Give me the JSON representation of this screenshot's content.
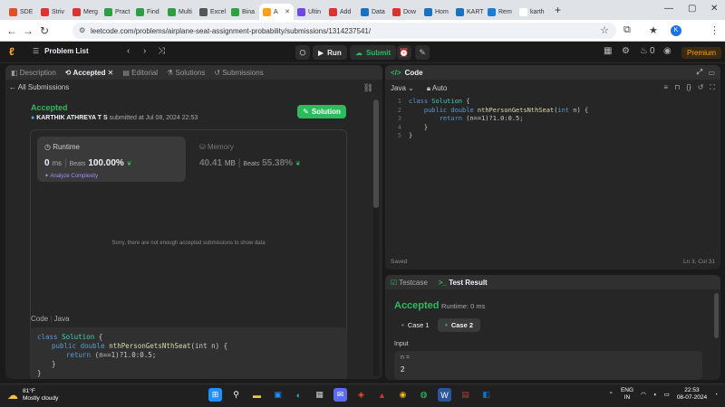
{
  "browser": {
    "tabs": [
      {
        "label": "SDE",
        "color": "#e44d26"
      },
      {
        "label": "Striv",
        "color": "#e03131"
      },
      {
        "label": "Merg",
        "color": "#e03131"
      },
      {
        "label": "Pract",
        "color": "#2f9e44"
      },
      {
        "label": "Find",
        "color": "#2f9e44"
      },
      {
        "label": "Multi",
        "color": "#2f9e44"
      },
      {
        "label": "Excel",
        "color": "#555555"
      },
      {
        "label": "Bina",
        "color": "#2f9e44"
      },
      {
        "label": "A",
        "color": "#ffa116",
        "active": true
      },
      {
        "label": "Ultin",
        "color": "#7048e8"
      },
      {
        "label": "Add",
        "color": "#e03131"
      },
      {
        "label": "Data",
        "color": "#1971c2"
      },
      {
        "label": "Dow",
        "color": "#e03131"
      },
      {
        "label": "Hom",
        "color": "#1971c2"
      },
      {
        "label": "KART",
        "color": "#1971c2"
      },
      {
        "label": "Rem",
        "color": "#1c7ed6"
      },
      {
        "label": "karth",
        "color": "#ffffff"
      }
    ],
    "url": "leetcode.com/problems/airplane-seat-assignment-probability/submissions/1314237541/",
    "profile_initial": "K"
  },
  "lc": {
    "problem_list": "Problem List",
    "run": "Run",
    "submit": "Submit",
    "streak": "0",
    "premium": "Premium"
  },
  "left": {
    "tabs": [
      "Description",
      "Accepted",
      "Editorial",
      "Solutions",
      "Submissions"
    ],
    "all_submissions": "All Submissions",
    "status": "Accepted",
    "author": "KARTHIK ATHREYA T S",
    "submitted": "submitted at Jul 08, 2024 22:53",
    "solution_btn": "Solution",
    "runtime": {
      "label": "Runtime",
      "value": "0",
      "unit": "ms",
      "beats_label": "Beats",
      "beats": "100.00%"
    },
    "analyze": "Analyze Complexity",
    "memory": {
      "label": "Memory",
      "value": "40.41",
      "unit": "MB",
      "beats_label": "Beats",
      "beats": "55.38%"
    },
    "nodata": "Sorry, there are not enough accepted submissions to show data",
    "code_label": "Code",
    "code_lang": "Java",
    "code": {
      "l1a": "class",
      "l1b": "Solution",
      "l1c": " {",
      "l2a": "public",
      "l2b": "double",
      "l2c": "nthPersonGetsNthSeat",
      "l2d": "(int n) {",
      "l3a": "return",
      "l3b": " (n==1)?1.0:0.5;",
      "l4": "}",
      "l5": "}"
    }
  },
  "editor": {
    "title": "Code",
    "lang": "Java",
    "mode": "Auto",
    "lines": [
      {
        "n": "1",
        "text": "class Solution {"
      },
      {
        "n": "2",
        "text": "    public double nthPersonGetsNthSeat(int n) {"
      },
      {
        "n": "3",
        "text": "        return (n==1)?1.0:0.5;"
      },
      {
        "n": "4",
        "text": "    }"
      },
      {
        "n": "5",
        "text": "}"
      }
    ],
    "saved": "Saved",
    "position": "Ln 3, Col 31"
  },
  "test": {
    "tab_testcase": "Testcase",
    "tab_result": "Test Result",
    "status": "Accepted",
    "runtime": "Runtime: 0 ms",
    "case1": "Case 1",
    "case2": "Case 2",
    "input_label": "Input",
    "var": "n =",
    "val": "2"
  },
  "taskbar": {
    "temp": "81°F",
    "weather": "Mostly cloudy",
    "lang1": "ENG",
    "lang2": "IN",
    "time": "22:53",
    "date": "08-07-2024"
  }
}
